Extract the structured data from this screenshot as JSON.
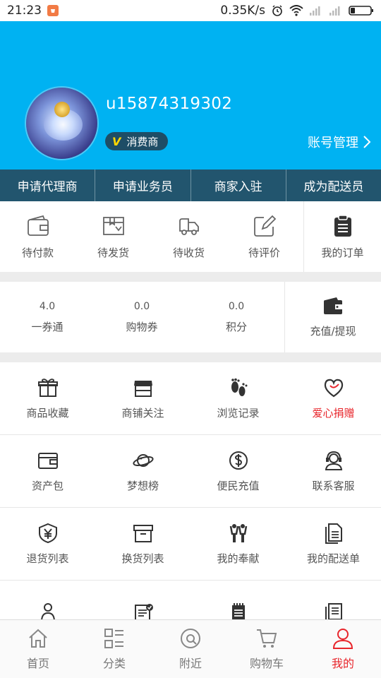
{
  "status_bar": {
    "time": "21:23",
    "speed": "0.35K/s"
  },
  "profile": {
    "username": "u15874319302",
    "badge_letter": "V",
    "badge_label": "消费商",
    "account_manage": "账号管理"
  },
  "roles": [
    "申请代理商",
    "申请业务员",
    "商家入驻",
    "成为配送员"
  ],
  "orders": {
    "items": [
      {
        "label": "待付款",
        "icon": "wallet-icon"
      },
      {
        "label": "待发货",
        "icon": "box-icon"
      },
      {
        "label": "待收货",
        "icon": "truck-icon"
      },
      {
        "label": "待评价",
        "icon": "edit-icon"
      }
    ],
    "my_orders": "我的订单"
  },
  "wallet": {
    "items": [
      {
        "value": "4.0",
        "label": "一券通"
      },
      {
        "value": "0.0",
        "label": "购物券"
      },
      {
        "value": "0.0",
        "label": "积分"
      }
    ],
    "recharge": "充值/提现"
  },
  "grid": {
    "rows": [
      [
        {
          "label": "商品收藏",
          "icon": "gift-icon"
        },
        {
          "label": "商铺关注",
          "icon": "shop-icon"
        },
        {
          "label": "浏览记录",
          "icon": "footprint-icon"
        },
        {
          "label": "爱心捐赠",
          "icon": "heart-icon"
        }
      ],
      [
        {
          "label": "资产包",
          "icon": "wallet-icon"
        },
        {
          "label": "梦想榜",
          "icon": "planet-icon"
        },
        {
          "label": "便民充值",
          "icon": "dollar-icon"
        },
        {
          "label": "联系客服",
          "icon": "headset-icon"
        }
      ],
      [
        {
          "label": "退货列表",
          "icon": "yen-shield-icon"
        },
        {
          "label": "换货列表",
          "icon": "archive-icon"
        },
        {
          "label": "我的奉献",
          "icon": "people-icon"
        },
        {
          "label": "我的配送单",
          "icon": "documents-icon"
        }
      ]
    ]
  },
  "bottom_nav": [
    {
      "label": "首页",
      "icon": "home-icon"
    },
    {
      "label": "分类",
      "icon": "category-icon"
    },
    {
      "label": "附近",
      "icon": "nearby-icon"
    },
    {
      "label": "购物车",
      "icon": "cart-icon"
    },
    {
      "label": "我的",
      "icon": "user-icon"
    }
  ],
  "colors": {
    "header": "#00b2f2",
    "role_bar": "#22556e",
    "accent_red": "#e8252b"
  }
}
